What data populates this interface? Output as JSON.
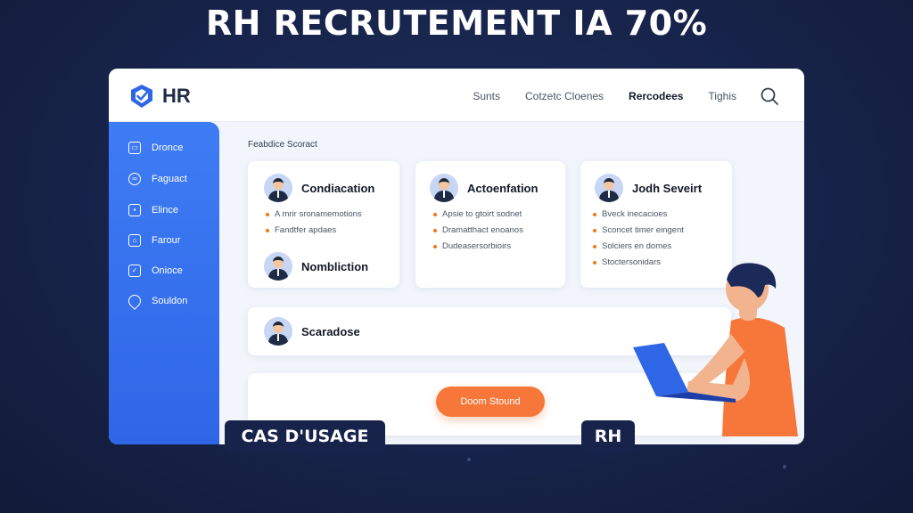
{
  "headline": "RH RECRUTEMENT IA 70%",
  "app": {
    "logo_text": "HR",
    "nav": [
      "Sunts",
      "Cotzetc Cloenes",
      "Rercodees",
      "Tighis"
    ],
    "nav_active_index": 2
  },
  "sidebar": {
    "items": [
      {
        "label": "Dronce",
        "icon": "window-icon"
      },
      {
        "label": "Faguact",
        "icon": "link-icon"
      },
      {
        "label": "Elince",
        "icon": "chat-icon"
      },
      {
        "label": "Farour",
        "icon": "image-icon"
      },
      {
        "label": "Onioce",
        "icon": "check-icon"
      },
      {
        "label": "Souldon",
        "icon": "location-icon"
      }
    ]
  },
  "content": {
    "section_title": "Feabdice Scoract",
    "cards": [
      {
        "candidates": [
          "Condiacation",
          "Nombliction"
        ],
        "bullets": [
          "A mrir sronamemotions",
          "Fandtfer apdaes"
        ]
      },
      {
        "candidates": [
          "Actoenfation"
        ],
        "bullets": [
          "Apsie to gtoirt sodnet",
          "Dramatthact enoanos",
          "Dudeasersorbioirs"
        ]
      },
      {
        "candidates": [
          "Jodh Seveirt"
        ],
        "bullets": [
          "Bveck inecacioes",
          "Sconcet timer eingent",
          "Solciers en domes",
          "Stoctersonidars"
        ]
      }
    ],
    "wide_card": {
      "candidate": "Scaradose"
    },
    "cta_label": "Doom Stound"
  },
  "tags": {
    "left": "CAS D'USAGE",
    "right": "RH"
  },
  "colors": {
    "background": "#17234a",
    "sidebar": "#3a74f0",
    "accent": "#f7773a"
  }
}
